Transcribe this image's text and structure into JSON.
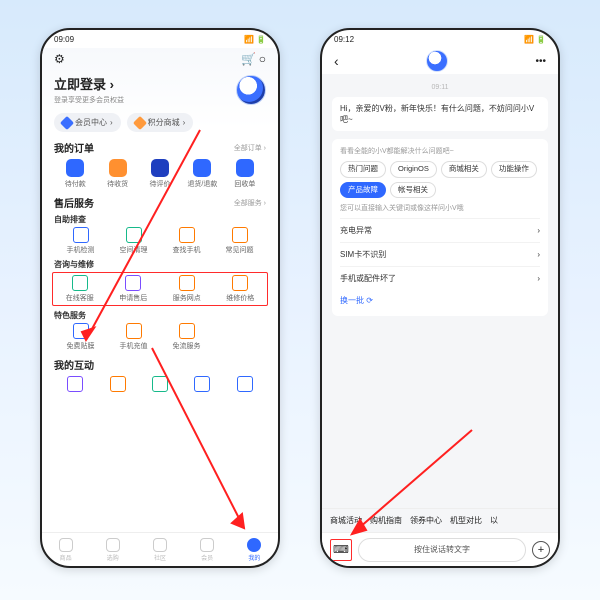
{
  "left": {
    "status_time": "09:09",
    "settings_icon": "⚙",
    "cart_icon": "🛒",
    "msg_icon": "○",
    "login_title": "立即登录",
    "login_arrow": "›",
    "login_sub": "登录享受更多会员权益",
    "pill1": "会员中心",
    "pill2": "积分商城",
    "orders_title": "我的订单",
    "orders_more": "全部订单 ›",
    "orders": [
      "待付款",
      "待收货",
      "待评价",
      "退货/退款",
      "回收单"
    ],
    "after_title": "售后服务",
    "after_more": "全部服务 ›",
    "self_tag": "自助排查",
    "self": [
      "手机检测",
      "空间清理",
      "查找手机",
      "常见问题"
    ],
    "consult_tag": "咨询与维修",
    "consult": [
      "在线客服",
      "申请售后",
      "服务网点",
      "维修价格"
    ],
    "special_tag": "特色服务",
    "special": [
      "免费贴膜",
      "手机充值",
      "免流服务"
    ],
    "inter_title": "我的互动",
    "nav": [
      "商品",
      "选购",
      "社区",
      "会员",
      "我的"
    ]
  },
  "right": {
    "status_time": "09:12",
    "back": "‹",
    "more": "•••",
    "time": "09:11",
    "greet": "Hi，亲爱的V粉，新年快乐！有什么问题，不妨问问小V吧~",
    "help_tip": "看看全能的小V都能解决什么问题吧~",
    "chips": [
      "热门问题",
      "OriginOS",
      "商城相关",
      "功能操作",
      "产品故障",
      "帐号相关"
    ],
    "chip_active_index": 4,
    "ask_tip": "您可以直接输入关键词或像这样问小V哦",
    "faq": [
      "充电异常",
      "SIM卡不识别",
      "手机或配件坏了"
    ],
    "refresh": "换一批 ⟳",
    "bottom_chips": [
      "商城活动",
      "购机指南",
      "领券中心",
      "机型对比",
      "以"
    ],
    "kb": "⌨",
    "speak": "按住说话转文字",
    "plus": "+"
  }
}
